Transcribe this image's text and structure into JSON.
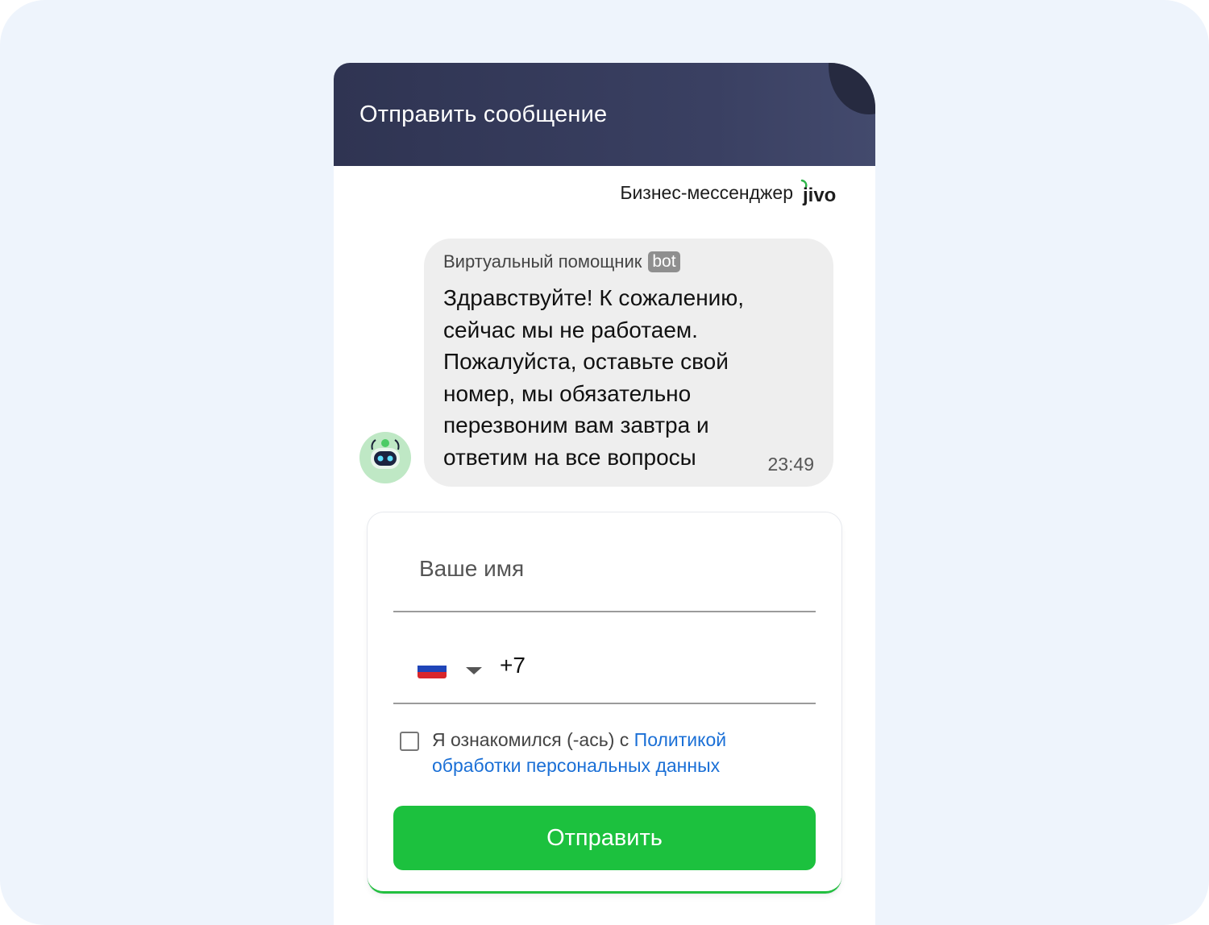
{
  "header": {
    "title": "Отправить сообщение"
  },
  "branding": {
    "text": "Бизнес-мессенджер",
    "logo": "jivo"
  },
  "message": {
    "sender": "Виртуальный помощник",
    "badge": "bot",
    "text": "Здравствуйте! К сожалению, сейчас мы не работаем. Пожалуйста, оставьте свой номер, мы обязательно перезвоним вам завтра и ответим на все вопросы",
    "time": "23:49",
    "avatar_icon": "robot-icon"
  },
  "form": {
    "name_placeholder": "Ваше имя",
    "phone": {
      "country_icon": "russia-flag-icon",
      "prefix": "+7"
    },
    "consent": {
      "text": "Я ознакомился (-ась) с ",
      "link": "Политикой обработки персональных данных"
    },
    "submit_label": "Отправить"
  },
  "colors": {
    "header": "#363b5a",
    "accent_green": "#1cc13e",
    "link_blue": "#1a6fd6",
    "bubble": "#eeeeee"
  }
}
